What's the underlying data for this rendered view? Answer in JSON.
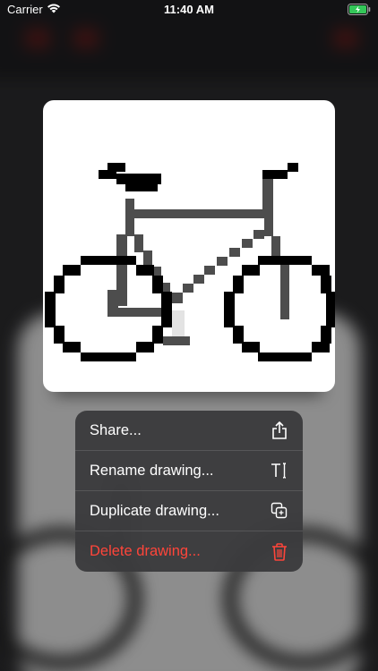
{
  "status_bar": {
    "carrier": "Carrier",
    "time": "11:40 AM",
    "wifi_icon": "wifi-icon",
    "battery_icon": "battery-charging-icon"
  },
  "preview": {
    "image": "pixel-art-bicycle"
  },
  "context_menu": {
    "items": [
      {
        "label": "Share...",
        "icon": "share-icon",
        "destructive": false
      },
      {
        "label": "Rename drawing...",
        "icon": "text-cursor-icon",
        "destructive": false
      },
      {
        "label": "Duplicate drawing...",
        "icon": "duplicate-icon",
        "destructive": false
      },
      {
        "label": "Delete drawing...",
        "icon": "trash-icon",
        "destructive": true
      }
    ]
  },
  "colors": {
    "destructive": "#ff453a",
    "menu_background": "#3a3a3c",
    "battery_green": "#34c759"
  }
}
